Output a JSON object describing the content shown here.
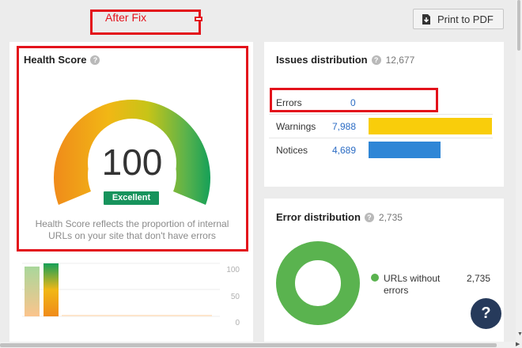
{
  "annotation": {
    "after_fix_label": "After Fix"
  },
  "toolbar": {
    "print_label": "Print to PDF"
  },
  "health": {
    "title": "Health Score",
    "help": "?",
    "score": "100",
    "score_fraction": 1.0,
    "badge": "Excellent",
    "description": "Health Score reflects the proportion of internal URLs on your site that don't have errors",
    "mini_chart": {
      "yticks": [
        "100",
        "50",
        "0"
      ]
    }
  },
  "issues": {
    "title": "Issues distribution",
    "help": "?",
    "total": "12,677",
    "rows": [
      {
        "label": "Errors",
        "value": "0",
        "color": "#e23e3e"
      },
      {
        "label": "Warnings",
        "value": "7,988",
        "color": "#f9cd0b"
      },
      {
        "label": "Notices",
        "value": "4,689",
        "color": "#2f86d6"
      }
    ]
  },
  "errors": {
    "title": "Error distribution",
    "help": "?",
    "total": "2,735",
    "legend": [
      {
        "label": "URLs without errors",
        "value": "2,735",
        "color": "#5ab34f"
      }
    ]
  },
  "fab": {
    "label": "?"
  },
  "colors": {
    "accent_red": "#e3121b",
    "green": "#17935c",
    "link": "#2b6cc4"
  }
}
